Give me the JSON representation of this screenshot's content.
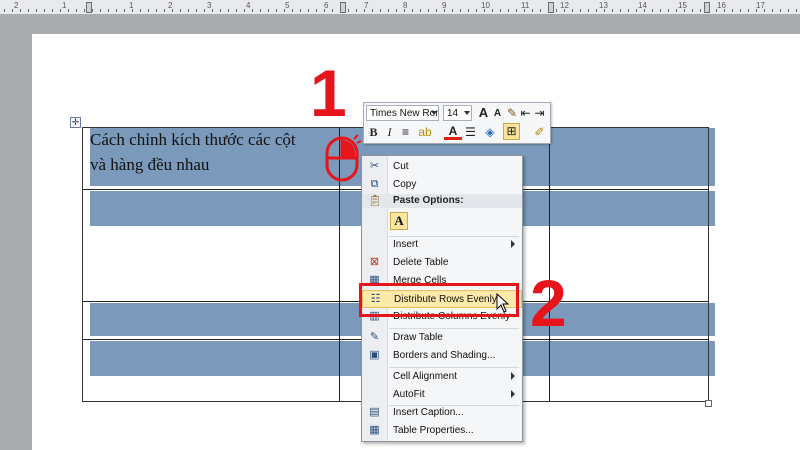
{
  "document": {
    "cell_text_line1": "Cách chỉnh kích thước các cột",
    "cell_text_line2": "và hàng đều nhau",
    "move_handle_glyph": "✛"
  },
  "annotations": {
    "step1": "1",
    "step2": "2",
    "color": "#e8141b"
  },
  "ruler": {
    "numbers": [
      "2",
      "1",
      "1",
      "2",
      "3",
      "4",
      "5",
      "6",
      "7",
      "8",
      "9",
      "10",
      "11",
      "12",
      "13",
      "14",
      "15",
      "16",
      "17"
    ]
  },
  "mini_toolbar": {
    "font_name": "Times New Ron",
    "font_size": "14",
    "grow_font": "A",
    "shrink_font": "A",
    "bold": "B",
    "italic": "I",
    "font_color_letter": "A"
  },
  "context_menu": {
    "items": [
      {
        "label": "Cut",
        "icon": "scissors-icon",
        "glyph": "✂"
      },
      {
        "label": "Copy",
        "icon": "copy-icon",
        "glyph": "⧉"
      },
      {
        "label": "Insert",
        "icon": "",
        "glyph": ""
      },
      {
        "label": "Delete Table",
        "icon": "delete-table-icon",
        "glyph": "⊠"
      },
      {
        "label": "Merge Cells",
        "icon": "merge-cells-icon",
        "glyph": "▦"
      },
      {
        "label": "Distribute Rows Evenly",
        "icon": "distribute-rows-icon",
        "glyph": "☷"
      },
      {
        "label": "Distribute Columns Evenly",
        "icon": "distribute-columns-icon",
        "glyph": "▥"
      },
      {
        "label": "Draw Table",
        "icon": "draw-table-icon",
        "glyph": "✎"
      },
      {
        "label": "Borders and Shading...",
        "icon": "borders-icon",
        "glyph": "▣"
      },
      {
        "label": "Cell Alignment",
        "icon": "",
        "glyph": ""
      },
      {
        "label": "AutoFit",
        "icon": "",
        "glyph": ""
      },
      {
        "label": "Insert Caption...",
        "icon": "caption-icon",
        "glyph": "▤"
      },
      {
        "label": "Table Properties...",
        "icon": "table-properties-icon",
        "glyph": "▦"
      }
    ],
    "paste_header": "Paste Options:",
    "paste_keep_text": "A"
  }
}
